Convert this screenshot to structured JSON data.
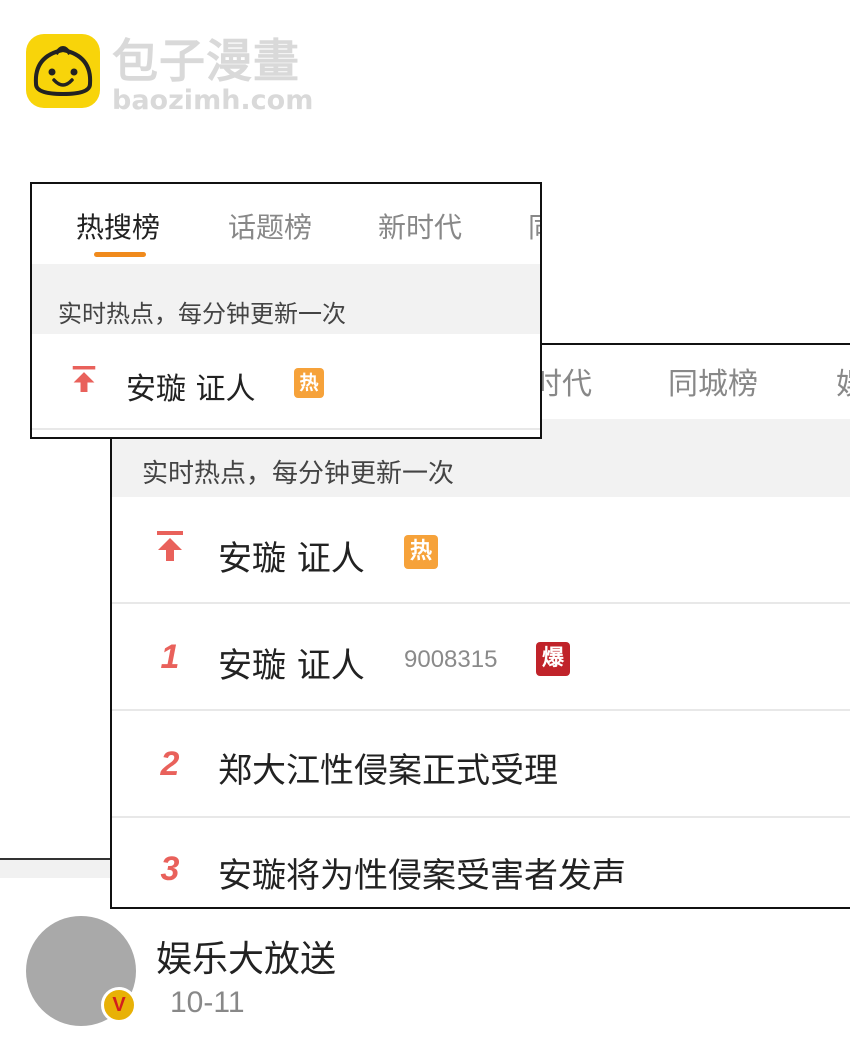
{
  "watermark": {
    "title": "包子漫畫",
    "url": "baozimh.com"
  },
  "panel_small": {
    "tabs": [
      "热搜榜",
      "话题榜",
      "新时代",
      "同"
    ],
    "notice": "实时热点，每分钟更新一次",
    "pinned": {
      "icon": "pin-top-icon",
      "title": "安璇 证人",
      "badge": "热"
    }
  },
  "panel_big": {
    "tabs": [
      "时代",
      "同城榜",
      "娱"
    ],
    "notice": "实时热点，每分钟更新一次",
    "pinned": {
      "icon": "pin-top-icon",
      "title": "安璇 证人",
      "badge": "热"
    },
    "items": [
      {
        "rank": "1",
        "title": "安璇 证人",
        "count": "9008315",
        "badge": "爆"
      },
      {
        "rank": "2",
        "title": "郑大江性侵案正式受理"
      },
      {
        "rank": "3",
        "title": "安璇将为性侵案受害者发声"
      }
    ]
  },
  "post": {
    "author": "娱乐大放送",
    "date": "10-11",
    "verified_badge": "V"
  },
  "colors": {
    "accent": "#f08a1c",
    "rank": "#e9615b",
    "hot": "#f6a23a",
    "boom": "#c0232a",
    "avatar": "#a9a9a9"
  }
}
